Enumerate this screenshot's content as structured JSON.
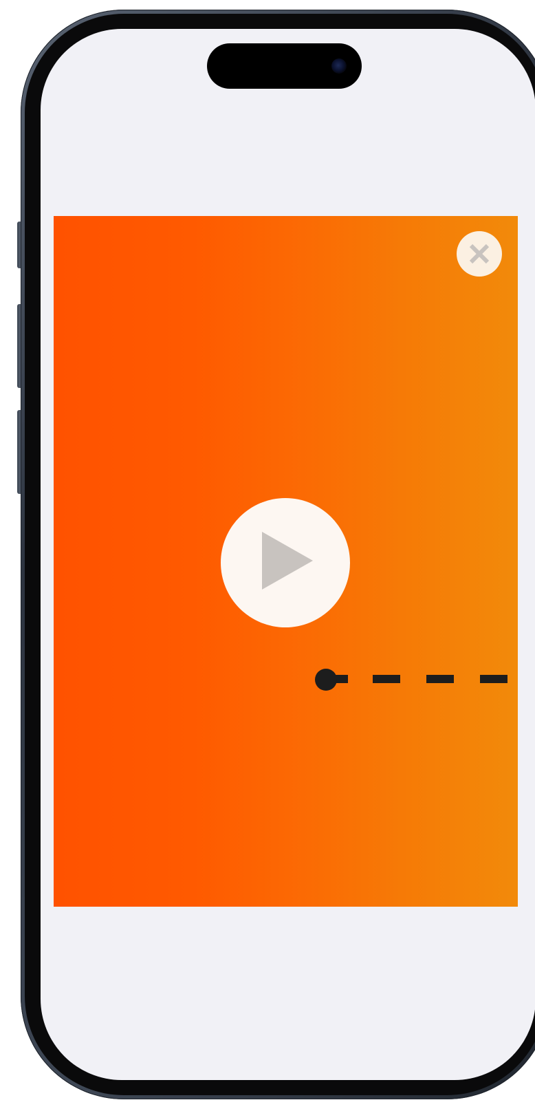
{
  "device": {
    "frame_color": "#3a4350",
    "screen_background": "#f1f1f6",
    "icons": [
      "dynamic-island",
      "camera"
    ]
  },
  "video": {
    "gradient_colors": [
      "#ff5200",
      "#f28a0a"
    ],
    "close_icon": "close-icon",
    "play_icon": "play-icon",
    "play_button_color": "#fdf7f2",
    "close_button_color": "#fbf0e2",
    "icon_color": "#c8c3bf"
  },
  "gesture_hint": {
    "handle_icon": "drag-handle-dot",
    "line_style": "dashed",
    "color": "#1d1d1d"
  }
}
